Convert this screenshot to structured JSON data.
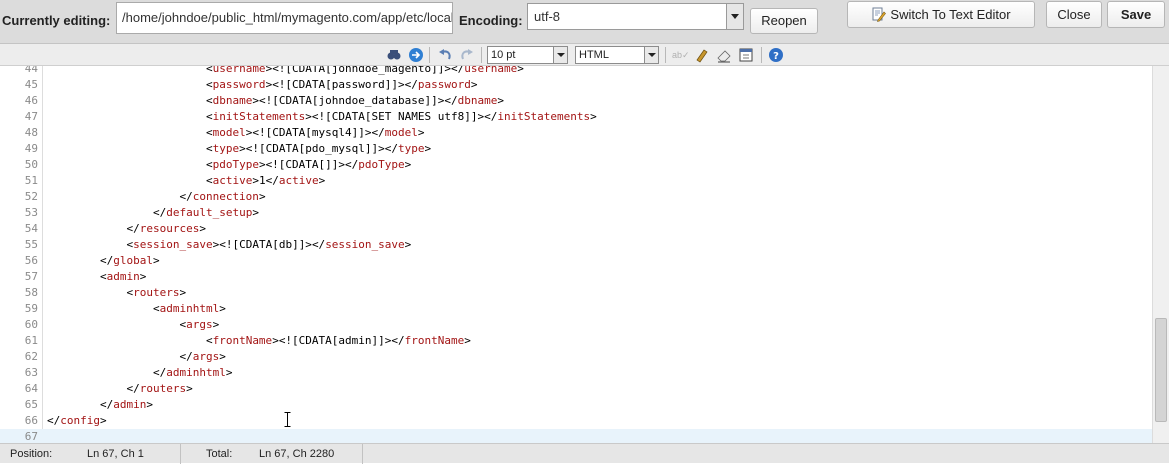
{
  "header": {
    "editing_label": "Currently editing:",
    "path_value": "/home/johndoe/public_html/mymagento.com/app/etc/local.xml",
    "encoding_label": "Encoding:",
    "encoding_value": "utf-8",
    "reopen_label": "Reopen",
    "switch_label": "Switch To Text Editor",
    "close_label": "Close",
    "save_label": "Save"
  },
  "toolbar": {
    "icons": [
      "find-replace-icon",
      "goto-icon",
      "undo-icon",
      "redo-icon",
      "spellcheck-icon",
      "highlight-icon",
      "eraser-icon",
      "fullscreen-icon",
      "help-icon"
    ],
    "font_size_value": "10 pt",
    "syntax_value": "HTML"
  },
  "editor": {
    "lines": [
      {
        "n": "44",
        "indent": "                        ",
        "parts": [
          [
            "p",
            "<"
          ],
          [
            "tag",
            "username"
          ],
          [
            "p",
            ">"
          ],
          [
            "txt",
            "<![CDATA[johndoe_magento]]>"
          ],
          [
            "p",
            "</"
          ],
          [
            "tag",
            "username"
          ],
          [
            "p",
            ">"
          ]
        ]
      },
      {
        "n": "45",
        "indent": "                        ",
        "parts": [
          [
            "p",
            "<"
          ],
          [
            "tag",
            "password"
          ],
          [
            "p",
            ">"
          ],
          [
            "txt",
            "<![CDATA[password]]>"
          ],
          [
            "p",
            "</"
          ],
          [
            "tag",
            "password"
          ],
          [
            "p",
            ">"
          ]
        ]
      },
      {
        "n": "46",
        "indent": "                        ",
        "parts": [
          [
            "p",
            "<"
          ],
          [
            "tag",
            "dbname"
          ],
          [
            "p",
            ">"
          ],
          [
            "txt",
            "<![CDATA[johndoe_database]]>"
          ],
          [
            "p",
            "</"
          ],
          [
            "tag",
            "dbname"
          ],
          [
            "p",
            ">"
          ]
        ]
      },
      {
        "n": "47",
        "indent": "                        ",
        "parts": [
          [
            "p",
            "<"
          ],
          [
            "tag",
            "initStatements"
          ],
          [
            "p",
            ">"
          ],
          [
            "txt",
            "<![CDATA[SET NAMES utf8]]>"
          ],
          [
            "p",
            "</"
          ],
          [
            "tag",
            "initStatements"
          ],
          [
            "p",
            ">"
          ]
        ]
      },
      {
        "n": "48",
        "indent": "                        ",
        "parts": [
          [
            "p",
            "<"
          ],
          [
            "tag",
            "model"
          ],
          [
            "p",
            ">"
          ],
          [
            "txt",
            "<![CDATA[mysql4]]>"
          ],
          [
            "p",
            "</"
          ],
          [
            "tag",
            "model"
          ],
          [
            "p",
            ">"
          ]
        ]
      },
      {
        "n": "49",
        "indent": "                        ",
        "parts": [
          [
            "p",
            "<"
          ],
          [
            "tag",
            "type"
          ],
          [
            "p",
            ">"
          ],
          [
            "txt",
            "<![CDATA[pdo_mysql]]>"
          ],
          [
            "p",
            "</"
          ],
          [
            "tag",
            "type"
          ],
          [
            "p",
            ">"
          ]
        ]
      },
      {
        "n": "50",
        "indent": "                        ",
        "parts": [
          [
            "p",
            "<"
          ],
          [
            "tag",
            "pdoType"
          ],
          [
            "p",
            ">"
          ],
          [
            "txt",
            "<![CDATA[]]>"
          ],
          [
            "p",
            "</"
          ],
          [
            "tag",
            "pdoType"
          ],
          [
            "p",
            ">"
          ]
        ]
      },
      {
        "n": "51",
        "indent": "                        ",
        "parts": [
          [
            "p",
            "<"
          ],
          [
            "tag",
            "active"
          ],
          [
            "p",
            ">"
          ],
          [
            "txt",
            "1"
          ],
          [
            "p",
            "</"
          ],
          [
            "tag",
            "active"
          ],
          [
            "p",
            ">"
          ]
        ]
      },
      {
        "n": "52",
        "indent": "                    ",
        "parts": [
          [
            "p",
            "</"
          ],
          [
            "tag",
            "connection"
          ],
          [
            "p",
            ">"
          ]
        ]
      },
      {
        "n": "53",
        "indent": "                ",
        "parts": [
          [
            "p",
            "</"
          ],
          [
            "tag",
            "default_setup"
          ],
          [
            "p",
            ">"
          ]
        ]
      },
      {
        "n": "54",
        "indent": "            ",
        "parts": [
          [
            "p",
            "</"
          ],
          [
            "tag",
            "resources"
          ],
          [
            "p",
            ">"
          ]
        ]
      },
      {
        "n": "55",
        "indent": "            ",
        "parts": [
          [
            "p",
            "<"
          ],
          [
            "tag",
            "session_save"
          ],
          [
            "p",
            ">"
          ],
          [
            "txt",
            "<![CDATA[db]]>"
          ],
          [
            "p",
            "</"
          ],
          [
            "tag",
            "session_save"
          ],
          [
            "p",
            ">"
          ]
        ]
      },
      {
        "n": "56",
        "indent": "        ",
        "parts": [
          [
            "p",
            "</"
          ],
          [
            "tag",
            "global"
          ],
          [
            "p",
            ">"
          ]
        ]
      },
      {
        "n": "57",
        "indent": "        ",
        "parts": [
          [
            "p",
            "<"
          ],
          [
            "tag",
            "admin"
          ],
          [
            "p",
            ">"
          ]
        ]
      },
      {
        "n": "58",
        "indent": "            ",
        "parts": [
          [
            "p",
            "<"
          ],
          [
            "tag",
            "routers"
          ],
          [
            "p",
            ">"
          ]
        ]
      },
      {
        "n": "59",
        "indent": "                ",
        "parts": [
          [
            "p",
            "<"
          ],
          [
            "tag",
            "adminhtml"
          ],
          [
            "p",
            ">"
          ]
        ]
      },
      {
        "n": "60",
        "indent": "                    ",
        "parts": [
          [
            "p",
            "<"
          ],
          [
            "tag",
            "args"
          ],
          [
            "p",
            ">"
          ]
        ]
      },
      {
        "n": "61",
        "indent": "                        ",
        "parts": [
          [
            "p",
            "<"
          ],
          [
            "tag",
            "frontName"
          ],
          [
            "p",
            ">"
          ],
          [
            "txt",
            "<![CDATA[admin]]>"
          ],
          [
            "p",
            "</"
          ],
          [
            "tag",
            "frontName"
          ],
          [
            "p",
            ">"
          ]
        ]
      },
      {
        "n": "62",
        "indent": "                    ",
        "parts": [
          [
            "p",
            "</"
          ],
          [
            "tag",
            "args"
          ],
          [
            "p",
            ">"
          ]
        ]
      },
      {
        "n": "63",
        "indent": "                ",
        "parts": [
          [
            "p",
            "</"
          ],
          [
            "tag",
            "adminhtml"
          ],
          [
            "p",
            ">"
          ]
        ]
      },
      {
        "n": "64",
        "indent": "            ",
        "parts": [
          [
            "p",
            "</"
          ],
          [
            "tag",
            "routers"
          ],
          [
            "p",
            ">"
          ]
        ]
      },
      {
        "n": "65",
        "indent": "        ",
        "parts": [
          [
            "p",
            "</"
          ],
          [
            "tag",
            "admin"
          ],
          [
            "p",
            ">"
          ]
        ]
      },
      {
        "n": "66",
        "indent": "",
        "parts": [
          [
            "p",
            "</"
          ],
          [
            "tag",
            "config"
          ],
          [
            "p",
            ">"
          ]
        ]
      },
      {
        "n": "67",
        "indent": "",
        "parts": []
      }
    ],
    "current_line": "67"
  },
  "status": {
    "position_label": "Position:",
    "position_value": "Ln 67, Ch 1",
    "total_label": "Total:",
    "total_value": "Ln 67, Ch 2280"
  },
  "colors": {
    "tag": "#a31515",
    "line_number": "#8a8a8a",
    "current_line_bg": "#e8f3fb"
  }
}
